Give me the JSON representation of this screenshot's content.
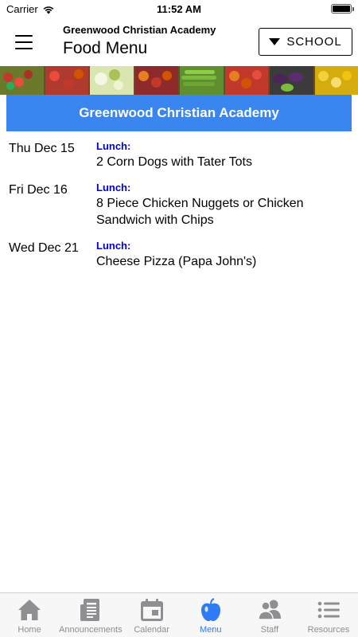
{
  "status_bar": {
    "carrier": "Carrier",
    "time": "11:52 AM",
    "wifi_icon": "wifi-icon",
    "battery_icon": "battery-icon"
  },
  "header": {
    "menu_icon": "hamburger-menu-icon",
    "subtitle": "Greenwood Christian Academy",
    "title": "Food Menu",
    "school_button": {
      "label": "SCHOOL",
      "icon": "triangle-down-icon"
    }
  },
  "banner": {
    "image": "produce-crates-banner"
  },
  "school_header": "Greenwood Christian Academy",
  "menu_entries": [
    {
      "date": "Thu Dec 15",
      "meal": "Lunch:",
      "item": "2 Corn Dogs with Tater Tots"
    },
    {
      "date": "Fri Dec 16",
      "meal": "Lunch:",
      "item": "8 Piece Chicken Nuggets or Chicken Sandwich with Chips"
    },
    {
      "date": "Wed Dec 21",
      "meal": "Lunch:",
      "item": "Cheese Pizza (Papa John's)"
    }
  ],
  "tab_bar": {
    "active_color": "#2f7bf5",
    "inactive_color": "#8e8e93",
    "tabs": [
      {
        "label": "Home",
        "icon": "home-icon",
        "active": false
      },
      {
        "label": "Announcements",
        "icon": "newspaper-icon",
        "active": false
      },
      {
        "label": "Calendar",
        "icon": "calendar-icon",
        "active": false
      },
      {
        "label": "Menu",
        "icon": "apple-icon",
        "active": true
      },
      {
        "label": "Staff",
        "icon": "people-icon",
        "active": false
      },
      {
        "label": "Resources",
        "icon": "list-icon",
        "active": false
      }
    ]
  },
  "colors": {
    "school_header_bg": "#3a86f0",
    "meal_label": "#0000d6"
  }
}
